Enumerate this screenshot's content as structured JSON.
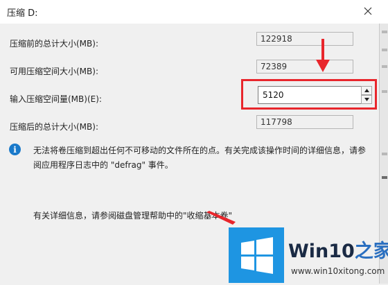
{
  "window": {
    "title": "压缩 D:"
  },
  "rows": [
    {
      "label": "压缩前的总计大小(MB):",
      "value": "122918"
    },
    {
      "label": "可用压缩空间大小(MB):",
      "value": "72389"
    },
    {
      "label": "输入压缩空间量(MB)(E):",
      "value": "5120"
    },
    {
      "label": "压缩后的总计大小(MB):",
      "value": "117798"
    }
  ],
  "info": {
    "icon": "info-icon",
    "message": "无法将卷压缩到超出任何不可移动的文件所在的点。有关完成该操作时间的详细信息，请参阅应用程序日志中的 \"defrag\" 事件。",
    "help_text": "有关详细信息，请参阅磁盘管理帮助中的\"收缩基本卷\""
  },
  "watermark": {
    "brand_part1": "Win10",
    "brand_part2": "之家",
    "site": "www.win10xitong.com"
  },
  "colors": {
    "highlight": "#e8262c",
    "info_blue": "#1979ca",
    "logo_blue": "#1e95e2"
  }
}
